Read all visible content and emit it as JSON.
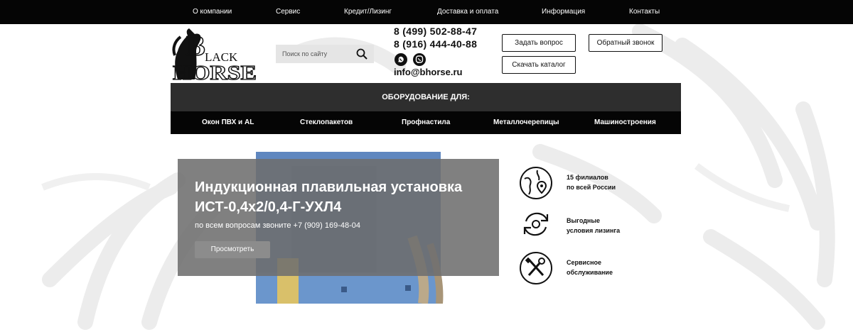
{
  "topnav": {
    "items": [
      {
        "label": "О компании"
      },
      {
        "label": "Сервис"
      },
      {
        "label": "Кредит/Лизинг"
      },
      {
        "label": "Доставка и оплата"
      },
      {
        "label": "Информация"
      },
      {
        "label": "Контакты"
      }
    ]
  },
  "header": {
    "logo_text_top": "LACK",
    "logo_text_bottom": "HORSE",
    "search": {
      "placeholder": "Поиск по сайту",
      "icon": "search-icon"
    },
    "phones": [
      "8 (499) 502-88-47",
      "8 (916) 444-40-88"
    ],
    "messengers": [
      {
        "icon": "whatsapp-icon"
      },
      {
        "icon": "viber-icon"
      }
    ],
    "email": "info@bhorse.ru",
    "buttons": {
      "ask": "Задать вопрос",
      "callback": "Обратный звонок",
      "catalog": "Скачать каталог"
    }
  },
  "equipment": {
    "title": "ОБОРУДОВАНИЕ ДЛЯ:",
    "categories": [
      {
        "label": "Окон ПВХ и AL"
      },
      {
        "label": "Стеклопакетов"
      },
      {
        "label": "Профнастила"
      },
      {
        "label": "Металлочерепицы"
      },
      {
        "label": "Машиностроения"
      }
    ]
  },
  "banner": {
    "title": "Индукционная плавильная установка ИСТ-0,4х2/0,4-Г-УХЛ4",
    "subtitle": "по всем вопросам звоните +7 (909) 169-48-04",
    "button_label": "Просмотреть"
  },
  "features": [
    {
      "icon": "globe-location-icon",
      "line1": "15 филиалов",
      "line2": "по всей России"
    },
    {
      "icon": "refresh-cycle-icon",
      "line1": "Выгодные",
      "line2": "условия лизинга"
    },
    {
      "icon": "tools-icon",
      "line1": "Сервисное",
      "line2": "обслуживание"
    }
  ],
  "colors": {
    "topbar": "#050505",
    "equip_title_bg": "#2e2e2e",
    "banner_overlay": "#6e6e6e",
    "banner_button": "#8c8c8c"
  }
}
